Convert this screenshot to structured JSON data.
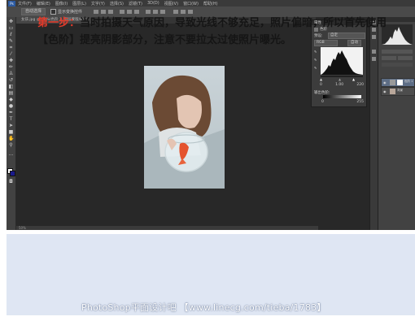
{
  "menubar": {
    "logo": "Ps",
    "items": [
      "文件(F)",
      "编辑(E)",
      "图像(I)",
      "图层(L)",
      "文字(Y)",
      "选择(S)",
      "滤镜(T)",
      "3D(D)",
      "视图(V)",
      "窗口(W)",
      "帮助(H)"
    ]
  },
  "options_bar": {
    "preset_select": "自动选择",
    "checkbox_label": "显示变换控件"
  },
  "document_tab": {
    "label": "女孩.jpg @ 50%(色阶 1, 图层蒙版/8) *"
  },
  "levels_panel": {
    "title": "属性",
    "subtitle": "色阶",
    "preset_label": "预设:",
    "preset_value": "自定",
    "channel_value": "RGB",
    "auto_label": "自动",
    "input_values": [
      "0",
      "1.00",
      "220"
    ],
    "output_label": "输出色阶:",
    "output_values": [
      "0",
      "255"
    ]
  },
  "layers_panel": {
    "layers": [
      {
        "name": "色阶 1"
      },
      {
        "name": "背景"
      }
    ]
  },
  "status_bar": {
    "zoom": "50%"
  },
  "caption": {
    "step_label": "第一步：",
    "text": "当时拍摄天气原因，导致光线不够充足，照片偏暗，所以首先使用【色阶】提亮阴影部分，注意不要拉太过使照片曝光。"
  },
  "watermark": "PhotoShop平面设计吧 【www.linecg.com/tieba/1783】",
  "colors": {
    "step_accent": "#e23a2a",
    "caption_bg": "#dfe6f3",
    "workspace_bg": "#282828"
  },
  "icons": [
    "move-tool-icon",
    "marquee-tool-icon",
    "lasso-tool-icon",
    "brush-tool-icon",
    "eye-icon",
    "histogram-icon"
  ]
}
